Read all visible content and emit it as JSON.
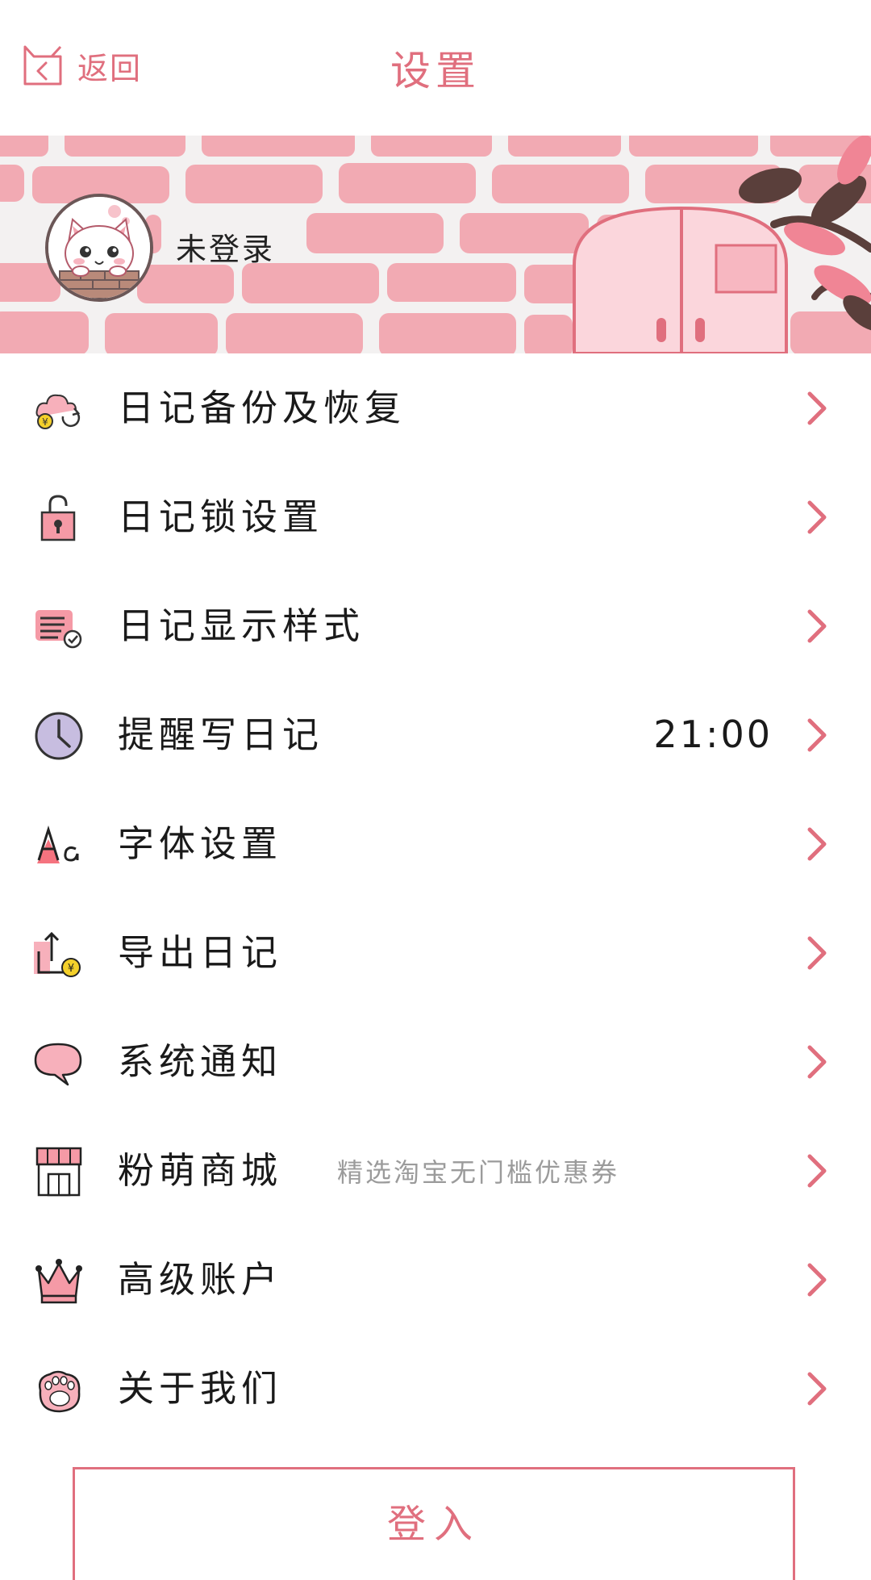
{
  "header": {
    "back_label": "返回",
    "title": "设置"
  },
  "profile": {
    "status": "未登录"
  },
  "menu": [
    {
      "label": "日记备份及恢复",
      "icon": "cloud-backup-icon"
    },
    {
      "label": "日记锁设置",
      "icon": "lock-icon"
    },
    {
      "label": "日记显示样式",
      "icon": "list-check-icon"
    },
    {
      "label": "提醒写日记",
      "icon": "clock-icon",
      "value": "21:00"
    },
    {
      "label": "字体设置",
      "icon": "font-icon"
    },
    {
      "label": "导出日记",
      "icon": "export-icon"
    },
    {
      "label": "系统通知",
      "icon": "speech-bubble-icon"
    },
    {
      "label": "粉萌商城",
      "icon": "shop-icon",
      "sub": "精选淘宝无门槛优惠券"
    },
    {
      "label": "高级账户",
      "icon": "crown-icon"
    },
    {
      "label": "关于我们",
      "icon": "paw-icon"
    }
  ],
  "login_button": "登入",
  "colors": {
    "accent": "#e06f7e",
    "brick": "#f2aab3",
    "door": "#fbd6dc"
  }
}
